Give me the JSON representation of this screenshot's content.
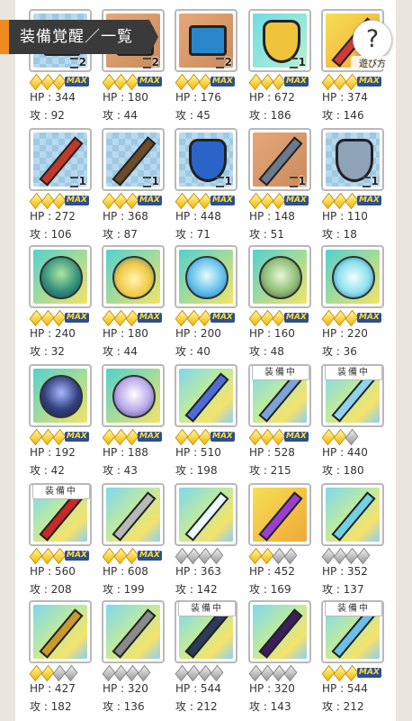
{
  "header": {
    "title": "装備覚醒／一覧"
  },
  "help": {
    "icon": "?",
    "label": "遊び方"
  },
  "equip_badge": "装備中",
  "max_badge": "MAX",
  "stat_labels": {
    "hp": "HP",
    "atk": "攻"
  },
  "items": [
    {
      "icon": "tan-block-icon",
      "tile": "stone",
      "stars": [
        1,
        1,
        1
      ],
      "max": true,
      "count": "2",
      "hp": "344",
      "atk": "92"
    },
    {
      "icon": "brown-block-icon",
      "tile": "skin",
      "stars": [
        1,
        1,
        1
      ],
      "max": true,
      "count": "2",
      "hp": "180",
      "atk": "44"
    },
    {
      "icon": "blue-gadget-icon",
      "tile": "skin",
      "stars": [
        1,
        1,
        1
      ],
      "max": true,
      "count": "2",
      "hp": "176",
      "atk": "45"
    },
    {
      "icon": "golden-shield-icon",
      "tile": "teal",
      "stars": [
        1,
        1,
        1
      ],
      "max": true,
      "count": "1",
      "hp": "672",
      "atk": "186"
    },
    {
      "icon": "red-flower-icon",
      "tile": "gold",
      "stars": [
        1,
        1,
        1
      ],
      "max": true,
      "count": "1",
      "hp": "374",
      "atk": "146"
    },
    {
      "icon": "scythe-icon",
      "tile": "stone",
      "stars": [
        1,
        1,
        1
      ],
      "max": true,
      "count": "1",
      "hp": "272",
      "atk": "106"
    },
    {
      "icon": "crossbow-icon",
      "tile": "stone",
      "stars": [
        1,
        1,
        1
      ],
      "max": true,
      "count": "1",
      "hp": "368",
      "atk": "87"
    },
    {
      "icon": "blue-shield-icon",
      "tile": "stone",
      "stars": [
        1,
        1,
        1
      ],
      "max": true,
      "count": "1",
      "hp": "448",
      "atk": "71"
    },
    {
      "icon": "spear-icon",
      "tile": "skin",
      "stars": [
        1,
        1,
        1
      ],
      "max": true,
      "count": "1",
      "hp": "148",
      "atk": "51"
    },
    {
      "icon": "kite-shield-icon",
      "tile": "stone",
      "stars": [
        1,
        1,
        1
      ],
      "max": true,
      "count": "1",
      "hp": "110",
      "atk": "18"
    },
    {
      "icon": "orb-forest-icon",
      "tile": "orb",
      "stars": [
        1,
        1,
        1
      ],
      "max": true,
      "hp": "240",
      "atk": "32"
    },
    {
      "icon": "orb-gold-icon",
      "tile": "orb",
      "stars": [
        1,
        1,
        1
      ],
      "max": true,
      "hp": "180",
      "atk": "44"
    },
    {
      "icon": "orb-sky-icon",
      "tile": "orb",
      "stars": [
        1,
        1,
        1
      ],
      "max": true,
      "hp": "200",
      "atk": "40"
    },
    {
      "icon": "orb-earth-icon",
      "tile": "orb",
      "stars": [
        1,
        1,
        1
      ],
      "max": true,
      "hp": "160",
      "atk": "48"
    },
    {
      "icon": "orb-ice-icon",
      "tile": "orb",
      "stars": [
        1,
        1,
        1
      ],
      "max": true,
      "hp": "220",
      "atk": "36"
    },
    {
      "icon": "orb-night-icon",
      "tile": "orb",
      "stars": [
        1,
        1,
        1
      ],
      "max": true,
      "hp": "192",
      "atk": "42"
    },
    {
      "icon": "orb-storm-icon",
      "tile": "orb",
      "stars": [
        1,
        1,
        1
      ],
      "max": true,
      "hp": "188",
      "atk": "43"
    },
    {
      "icon": "blue-sword-icon",
      "tile": "rain",
      "stars": [
        1,
        1,
        1
      ],
      "max": true,
      "hp": "510",
      "atk": "198"
    },
    {
      "icon": "gold-hilt-sword-icon",
      "tile": "rain",
      "stars": [
        1,
        1,
        1
      ],
      "max": true,
      "equipped": true,
      "hp": "528",
      "atk": "215"
    },
    {
      "icon": "crystal-sword-icon",
      "tile": "rain",
      "stars": [
        1,
        1,
        0
      ],
      "equipped": true,
      "hp": "440",
      "atk": "180"
    },
    {
      "icon": "red-axe-icon",
      "tile": "rain",
      "stars": [
        1,
        1,
        1
      ],
      "max": true,
      "equipped": true,
      "hp": "560",
      "atk": "208"
    },
    {
      "icon": "broad-sword-icon",
      "tile": "rain",
      "stars": [
        1,
        1,
        1
      ],
      "max": true,
      "hp": "608",
      "atk": "199"
    },
    {
      "icon": "magic-wand-icon",
      "tile": "rain",
      "stars": [
        0,
        0,
        0,
        0
      ],
      "hp": "363",
      "atk": "142"
    },
    {
      "icon": "purple-whip-icon",
      "tile": "gold",
      "stars": [
        1,
        1,
        0,
        0
      ],
      "hp": "452",
      "atk": "169"
    },
    {
      "icon": "jewel-sword-icon",
      "tile": "rain",
      "stars": [
        0,
        0,
        0,
        0
      ],
      "hp": "352",
      "atk": "137"
    },
    {
      "icon": "war-hammer-icon",
      "tile": "rain",
      "stars": [
        1,
        1,
        0,
        0
      ],
      "hp": "427",
      "atk": "182"
    },
    {
      "icon": "pickaxe-icon",
      "tile": "rain",
      "stars": [
        0,
        0,
        0,
        0
      ],
      "hp": "320",
      "atk": "136"
    },
    {
      "icon": "battle-axe-icon",
      "tile": "rain",
      "stars": [
        0,
        0,
        0,
        0
      ],
      "equipped": true,
      "hp": "544",
      "atk": "212"
    },
    {
      "icon": "dark-scythe-icon",
      "tile": "rain",
      "stars": [
        0,
        0,
        0,
        0
      ],
      "hp": "320",
      "atk": "143"
    },
    {
      "icon": "ice-trident-icon",
      "tile": "rain",
      "stars": [
        1,
        1,
        1
      ],
      "max": true,
      "equipped": true,
      "hp": "544",
      "atk": "212"
    }
  ]
}
